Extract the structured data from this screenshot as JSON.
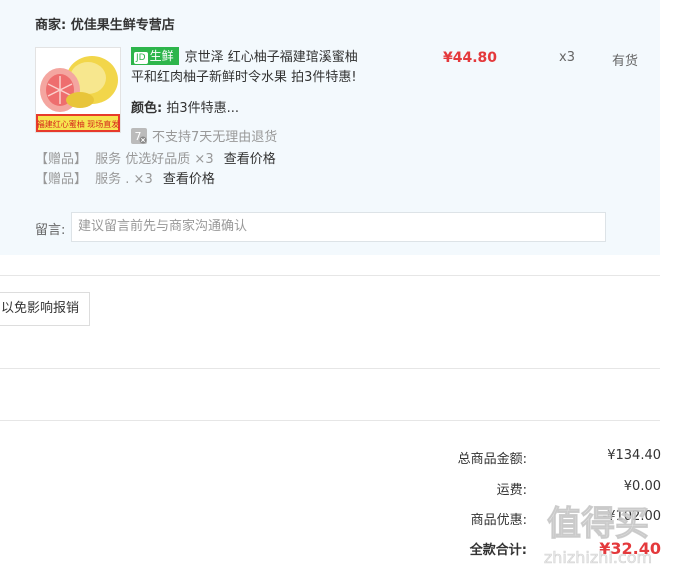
{
  "merchant": {
    "label": "商家:",
    "name": "优佳果生鲜专营店"
  },
  "product": {
    "fresh_tag": "生鲜",
    "fresh_mark": "JD",
    "title_line1": "京世泽 红心柚子福建琯溪蜜柚",
    "title_line2": "平和红肉柚子新鲜时令水果 拍3件特惠!",
    "price": "¥44.80",
    "qty": "x3",
    "stock": "有货",
    "color_label": "颜色:",
    "color_value": "拍3件特惠...",
    "noreturn_text": "不支持7天无理由退货",
    "image_text_1": "福建红心蜜柚 现场直发"
  },
  "gifts": [
    {
      "tag": "【赠品】",
      "text": "服务 优选好品质 ×3",
      "link": "查看价格"
    },
    {
      "tag": "【赠品】",
      "text": "服务 . ×3",
      "link": "查看价格"
    }
  ],
  "note": {
    "label": "留言:",
    "placeholder": "建议留言前先与商家沟通确认"
  },
  "tip_button": "以免影响报销",
  "summary": {
    "items_label": "总商品金额:",
    "items_value": "¥134.40",
    "shipping_label": "运费:",
    "shipping_value": "¥0.00",
    "discount_label": "商品优惠:",
    "discount_value": "-¥102.00",
    "total_label": "全款合计:",
    "total_value": "¥32.40"
  },
  "watermark": {
    "text1": "值得买",
    "text2": "zhizhizhi.com"
  },
  "colors": {
    "panel_bg": "#f3f9fd",
    "price_red": "#e4393c",
    "fresh_green": "#2db54b"
  }
}
